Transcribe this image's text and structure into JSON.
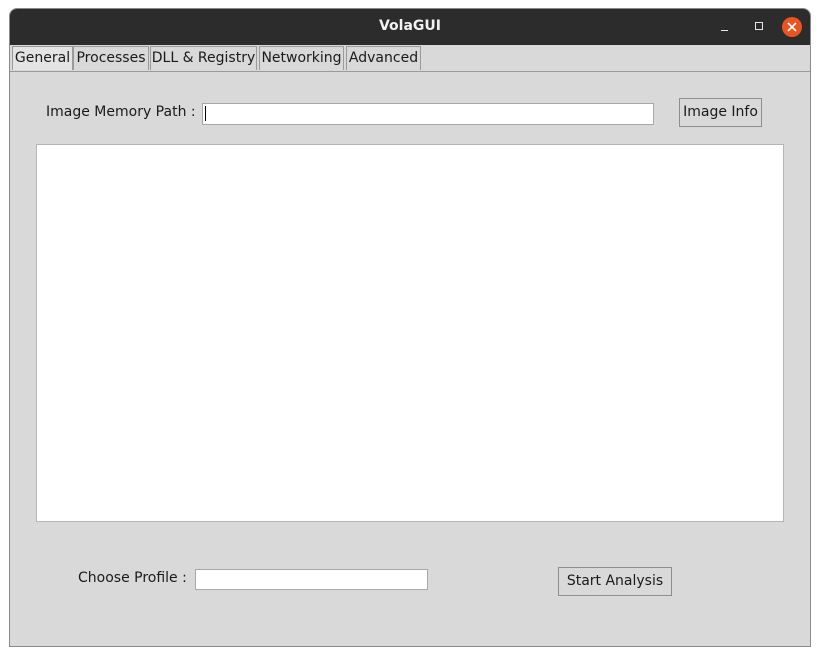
{
  "window": {
    "title": "VolaGUI"
  },
  "tabs": [
    {
      "label": "General",
      "active": true
    },
    {
      "label": "Processes",
      "active": false
    },
    {
      "label": "DLL & Registry",
      "active": false
    },
    {
      "label": "Networking",
      "active": false
    },
    {
      "label": "Advanced",
      "active": false
    }
  ],
  "general": {
    "image_path_label": "Image Memory Path :",
    "image_path_value": "",
    "image_info_button": "Image Info",
    "output_text": "",
    "profile_label": "Choose Profile :",
    "profile_value": "",
    "start_button": "Start Analysis"
  },
  "colors": {
    "titlebar": "#2c2c2c",
    "window_bg": "#d9d9d9",
    "close_button": "#e95420"
  },
  "icons": {
    "minimize": "minimize-icon",
    "maximize": "maximize-icon",
    "close": "close-icon"
  }
}
